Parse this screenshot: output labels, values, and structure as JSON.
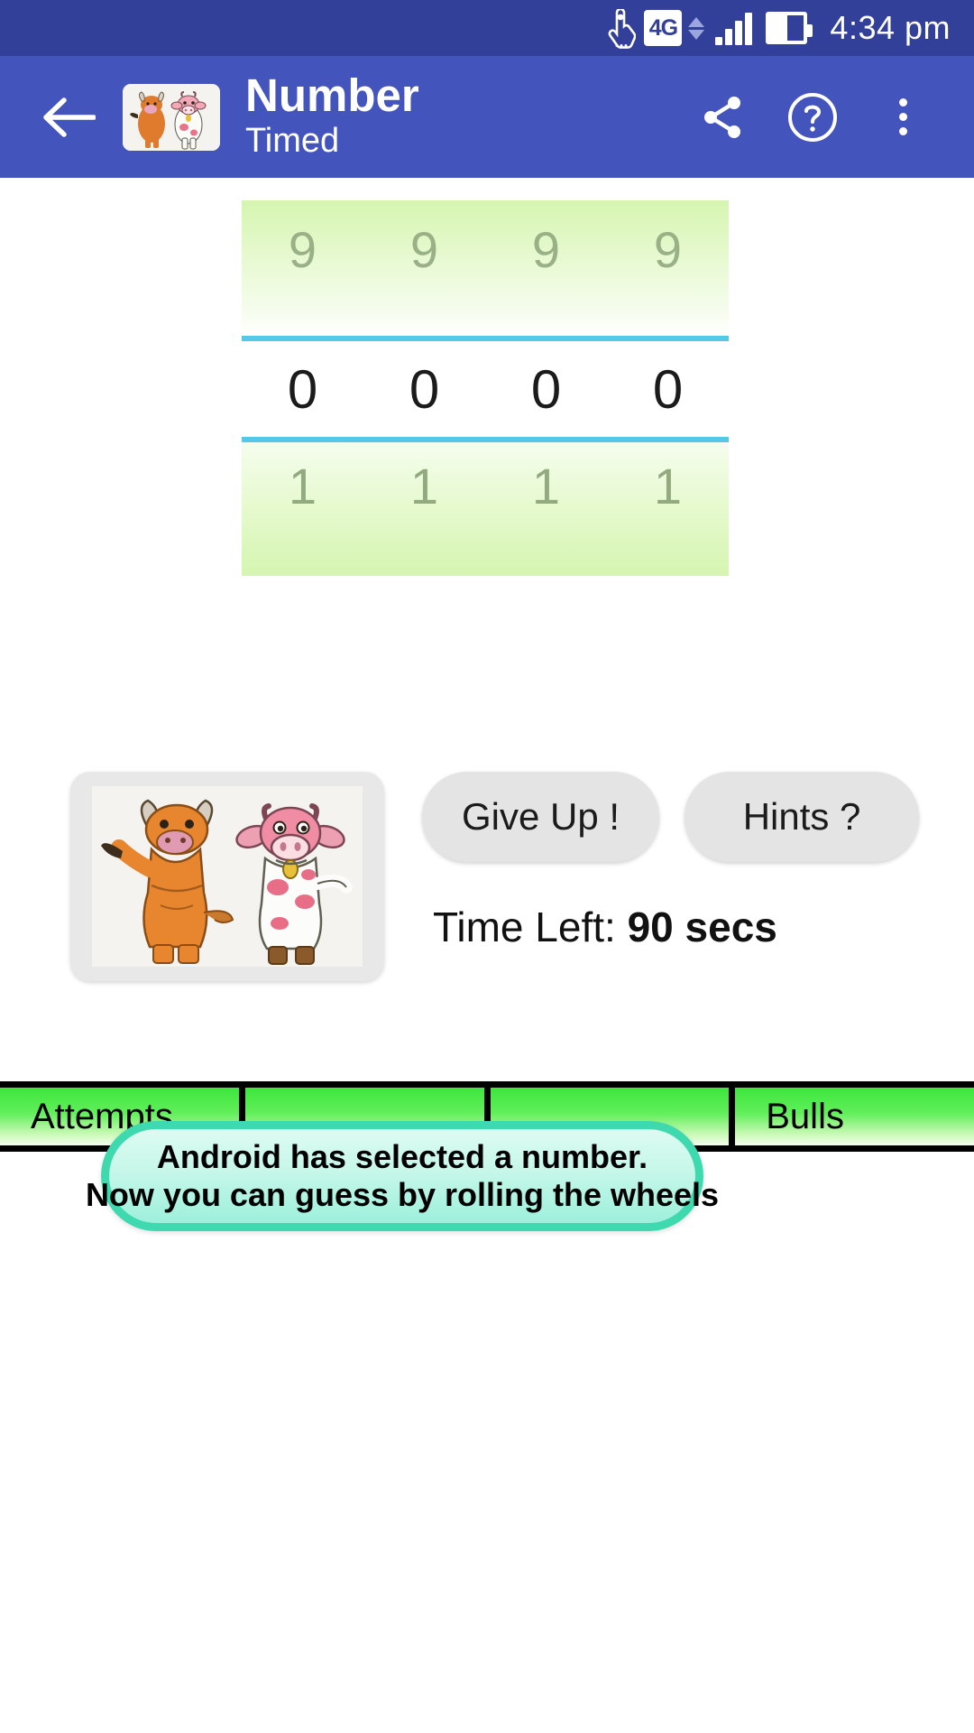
{
  "status_bar": {
    "network_type": "4G",
    "time": "4:34 pm",
    "icons": [
      "touch-pointer-icon",
      "network-4g-icon",
      "data-transfer-icon",
      "signal-bars-icon",
      "battery-icon"
    ]
  },
  "app_bar": {
    "back_icon": "back-arrow-icon",
    "app_logo": "bull-and-cow-logo",
    "title": "Number",
    "subtitle": "Timed",
    "actions": [
      {
        "name": "share-icon",
        "label": "Share"
      },
      {
        "name": "help-icon",
        "label": "Help"
      },
      {
        "name": "overflow-menu-icon",
        "label": "More options"
      }
    ]
  },
  "wheels": {
    "top_row": [
      "9",
      "9",
      "9",
      "9"
    ],
    "selected_row": [
      "0",
      "0",
      "0",
      "0"
    ],
    "bottom_row": [
      "1",
      "1",
      "1",
      "1"
    ],
    "divider_color": "#55c8e8",
    "highlight_color": "#d5f5b0"
  },
  "actions": {
    "image_button_name": "bull-and-cow-image-button",
    "give_up_label": "Give Up !",
    "hints_label": "Hints ?"
  },
  "timer": {
    "label": "Time Left: ",
    "value": "90 secs"
  },
  "table": {
    "columns": [
      "Attempts",
      "",
      "",
      "Bulls"
    ]
  },
  "toast": {
    "line1": "Android has selected a number.",
    "line2": "Now you can guess by rolling the wheels",
    "border_color": "#3fd9b0",
    "background_color": "#c6f7e9"
  }
}
